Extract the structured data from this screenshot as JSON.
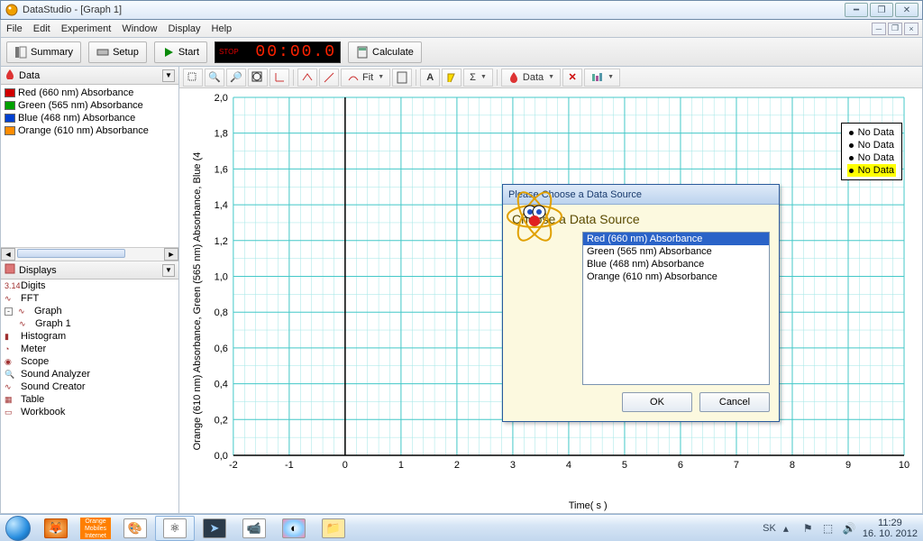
{
  "window": {
    "title": "DataStudio - [Graph 1]"
  },
  "menu": {
    "file": "File",
    "edit": "Edit",
    "experiment": "Experiment",
    "window": "Window",
    "display": "Display",
    "help": "Help"
  },
  "toolbar": {
    "summary": "Summary",
    "setup": "Setup",
    "start": "Start",
    "calculate": "Calculate",
    "timer_stop": "STOP",
    "timer_value": "00:00.0"
  },
  "data_panel": {
    "title": "Data",
    "items": [
      {
        "color": "#d00000",
        "label": "Red (660 nm) Absorbance"
      },
      {
        "color": "#00a000",
        "label": "Green (565 nm) Absorbance"
      },
      {
        "color": "#0040d0",
        "label": "Blue (468 nm) Absorbance"
      },
      {
        "color": "#ff8c00",
        "label": "Orange (610 nm) Absorbance"
      }
    ]
  },
  "displays_panel": {
    "title": "Displays",
    "items": [
      {
        "icon": "digits-icon",
        "label": "Digits"
      },
      {
        "icon": "fft-icon",
        "label": "FFT"
      },
      {
        "icon": "graph-icon",
        "label": "Graph",
        "expandable": true,
        "children": [
          {
            "icon": "graph-icon",
            "label": "Graph 1"
          }
        ]
      },
      {
        "icon": "histogram-icon",
        "label": "Histogram"
      },
      {
        "icon": "meter-icon",
        "label": "Meter"
      },
      {
        "icon": "scope-icon",
        "label": "Scope"
      },
      {
        "icon": "sound-analyzer-icon",
        "label": "Sound Analyzer"
      },
      {
        "icon": "sound-creator-icon",
        "label": "Sound Creator"
      },
      {
        "icon": "table-icon",
        "label": "Table"
      },
      {
        "icon": "workbook-icon",
        "label": "Workbook"
      }
    ]
  },
  "graph_toolbar": {
    "fit": "Fit",
    "data": "Data"
  },
  "chart_data": {
    "type": "line",
    "title": "",
    "xlabel": "Time( s )",
    "ylabel": "Orange (610 nm) Absorbance, Green (565 nm) Absorbance, Blue (4",
    "xlim": [
      -2,
      10
    ],
    "ylim": [
      0.0,
      2.0
    ],
    "xticks": [
      -2,
      -1,
      0,
      1,
      2,
      3,
      4,
      5,
      6,
      7,
      8,
      9,
      10
    ],
    "yticks": [
      0.0,
      0.2,
      0.4,
      0.6,
      0.8,
      1.0,
      1.2,
      1.4,
      1.6,
      1.8,
      2.0
    ],
    "series": [
      {
        "name": "No Data",
        "color": "#000000",
        "values": []
      },
      {
        "name": "No Data",
        "color": "#000000",
        "values": []
      },
      {
        "name": "No Data",
        "color": "#000000",
        "values": []
      },
      {
        "name": "No Data",
        "color": "#000000",
        "values": [],
        "highlight": true
      }
    ]
  },
  "dialog": {
    "title": "Please Choose a Data Source",
    "heading": "Choose a Data Source",
    "options": [
      "Red (660 nm) Absorbance",
      "Green (565 nm) Absorbance",
      "Blue (468 nm) Absorbance",
      "Orange (610 nm) Absorbance"
    ],
    "selected": 0,
    "ok": "OK",
    "cancel": "Cancel"
  },
  "taskbar": {
    "lang": "SK",
    "time": "11:29",
    "date": "16. 10. 2012",
    "orange_label": "Orange Mobiles Internet"
  }
}
